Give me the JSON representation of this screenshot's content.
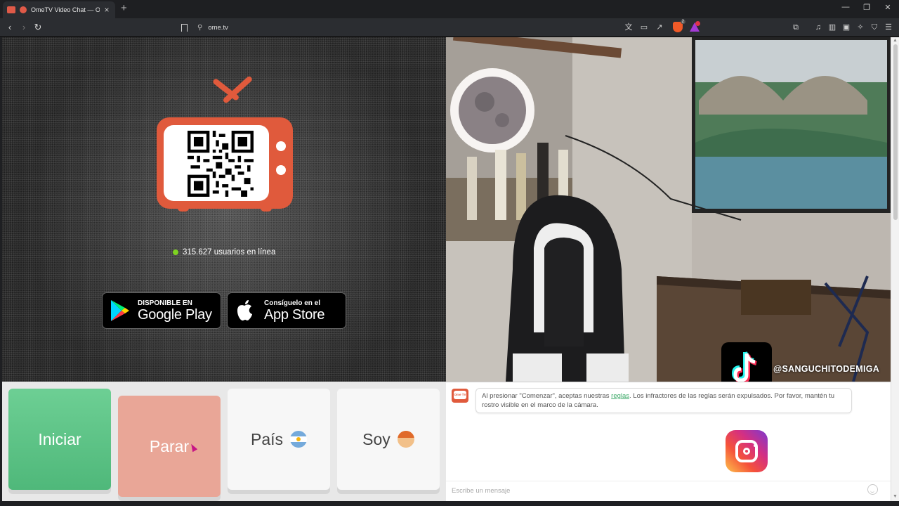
{
  "browser": {
    "tab_title": "OmeTV Video Chat — Omeg",
    "url": "ome.tv",
    "brave_badge": "2"
  },
  "stranger": {
    "online_count_text": "315.627 usuarios en línea",
    "google_play": {
      "small": "DISPONIBLE EN",
      "big": "Google Play"
    },
    "app_store": {
      "small": "Consíguelo en el",
      "big": "App Store"
    }
  },
  "webcam": {
    "overlay_handle": "@SANGUCHITODEMIGA"
  },
  "controls": {
    "start_label": "Iniciar",
    "stop_label": "Parar",
    "country_label": "País",
    "gender_label": "Soy"
  },
  "chat": {
    "logo_text": "Ome TV",
    "system_message_before": "Al presionar \"Comenzar\", aceptas nuestras ",
    "rules_link": "reglas",
    "system_message_after": ". Los infractores de las reglas serán expulsados. Por favor, mantén tu rostro visible en el marco de la cámara.",
    "input_placeholder": "Escribe un mensaje"
  },
  "colors": {
    "brand_orange": "#e05a3c",
    "start_green": "#5cc486",
    "stop_salmon": "#e9a697",
    "online_green": "#7ed321"
  },
  "icons": [
    "back-icon",
    "forward-icon",
    "reload-icon",
    "bookmark-icon",
    "translate-icon",
    "cast-icon",
    "share-icon",
    "brave-shields-icon",
    "brave-rewards-icon",
    "extensions-icon",
    "media-icon",
    "sidebar-icon",
    "wallet-icon",
    "leo-icon",
    "vpn-icon",
    "menu-icon",
    "google-play-icon",
    "apple-icon",
    "tiktok-icon",
    "instagram-icon",
    "emoji-icon"
  ]
}
